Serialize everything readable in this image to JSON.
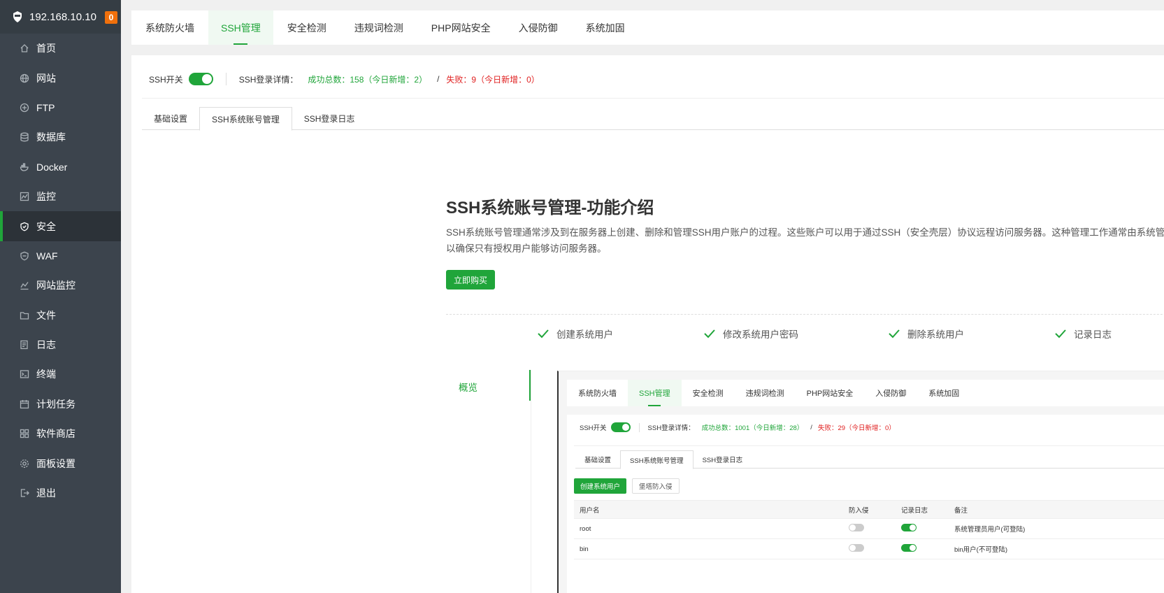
{
  "sidebar": {
    "server_ip": "192.168.10.10",
    "badge_count": "0",
    "items": [
      {
        "label": "首页",
        "icon": "home-icon"
      },
      {
        "label": "网站",
        "icon": "globe-icon"
      },
      {
        "label": "FTP",
        "icon": "ftp-icon"
      },
      {
        "label": "数据库",
        "icon": "database-icon"
      },
      {
        "label": "Docker",
        "icon": "docker-icon"
      },
      {
        "label": "监控",
        "icon": "monitor-icon"
      },
      {
        "label": "安全",
        "icon": "shield-icon",
        "active": true
      },
      {
        "label": "WAF",
        "icon": "waf-shield-icon"
      },
      {
        "label": "网站监控",
        "icon": "chart-line-icon"
      },
      {
        "label": "文件",
        "icon": "folder-icon"
      },
      {
        "label": "日志",
        "icon": "log-icon"
      },
      {
        "label": "终端",
        "icon": "terminal-icon"
      },
      {
        "label": "计划任务",
        "icon": "calendar-icon"
      },
      {
        "label": "软件商店",
        "icon": "apps-icon"
      },
      {
        "label": "面板设置",
        "icon": "gear-icon"
      },
      {
        "label": "退出",
        "icon": "logout-icon"
      }
    ]
  },
  "top_tabs": [
    "系统防火墙",
    "SSH管理",
    "安全检测",
    "违规词检测",
    "PHP网站安全",
    "入侵防御",
    "系统加固"
  ],
  "top_tabs_active": 1,
  "status": {
    "ssh_switch_label": "SSH开关",
    "login_detail_label": "SSH登录详情：",
    "success_text": "成功总数：158（今日新增：2）",
    "slash": "/",
    "fail_text": "失败：9（今日新增：0）"
  },
  "sub_tabs": [
    "基础设置",
    "SSH系统账号管理",
    "SSH登录日志"
  ],
  "sub_tabs_active": 1,
  "intro": {
    "title": "SSH系统账号管理-功能介绍",
    "description": "SSH系统账号管理通常涉及到在服务器上创建、删除和管理SSH用户账户的过程。这些账户可以用于通过SSH（安全壳层）协议远程访问服务器。这种管理工作通常由系统管理员执行，以确保只有授权用户能够访问服务器。",
    "buy_button": "立即购买"
  },
  "features": [
    "创建系统用户",
    "修改系统用户密码",
    "删除系统用户",
    "记录日志"
  ],
  "overview_label": "概览",
  "preview": {
    "top_tabs": [
      "系统防火墙",
      "SSH管理",
      "安全检测",
      "违规词检测",
      "PHP网站安全",
      "入侵防御",
      "系统加固"
    ],
    "ssh_switch_label": "SSH开关",
    "login_detail_label": "SSH登录详情：",
    "success_text": "成功总数：1001（今日新增：28）",
    "slash": "/",
    "fail_text": "失败：29（今日新增：0）",
    "sub_tabs": [
      "基础设置",
      "SSH系统账号管理",
      "SSH登录日志"
    ],
    "create_button": "创建系统用户",
    "protect_button": "堡塔防入侵",
    "columns": [
      "用户名",
      "防入侵",
      "记录日志",
      "备注"
    ],
    "rows": [
      {
        "username": "root",
        "protect": false,
        "log": true,
        "note": "系统管理员用户(可登陆)"
      },
      {
        "username": "bin",
        "protect": false,
        "log": true,
        "note": "bin用户(不可登陆)"
      }
    ]
  }
}
